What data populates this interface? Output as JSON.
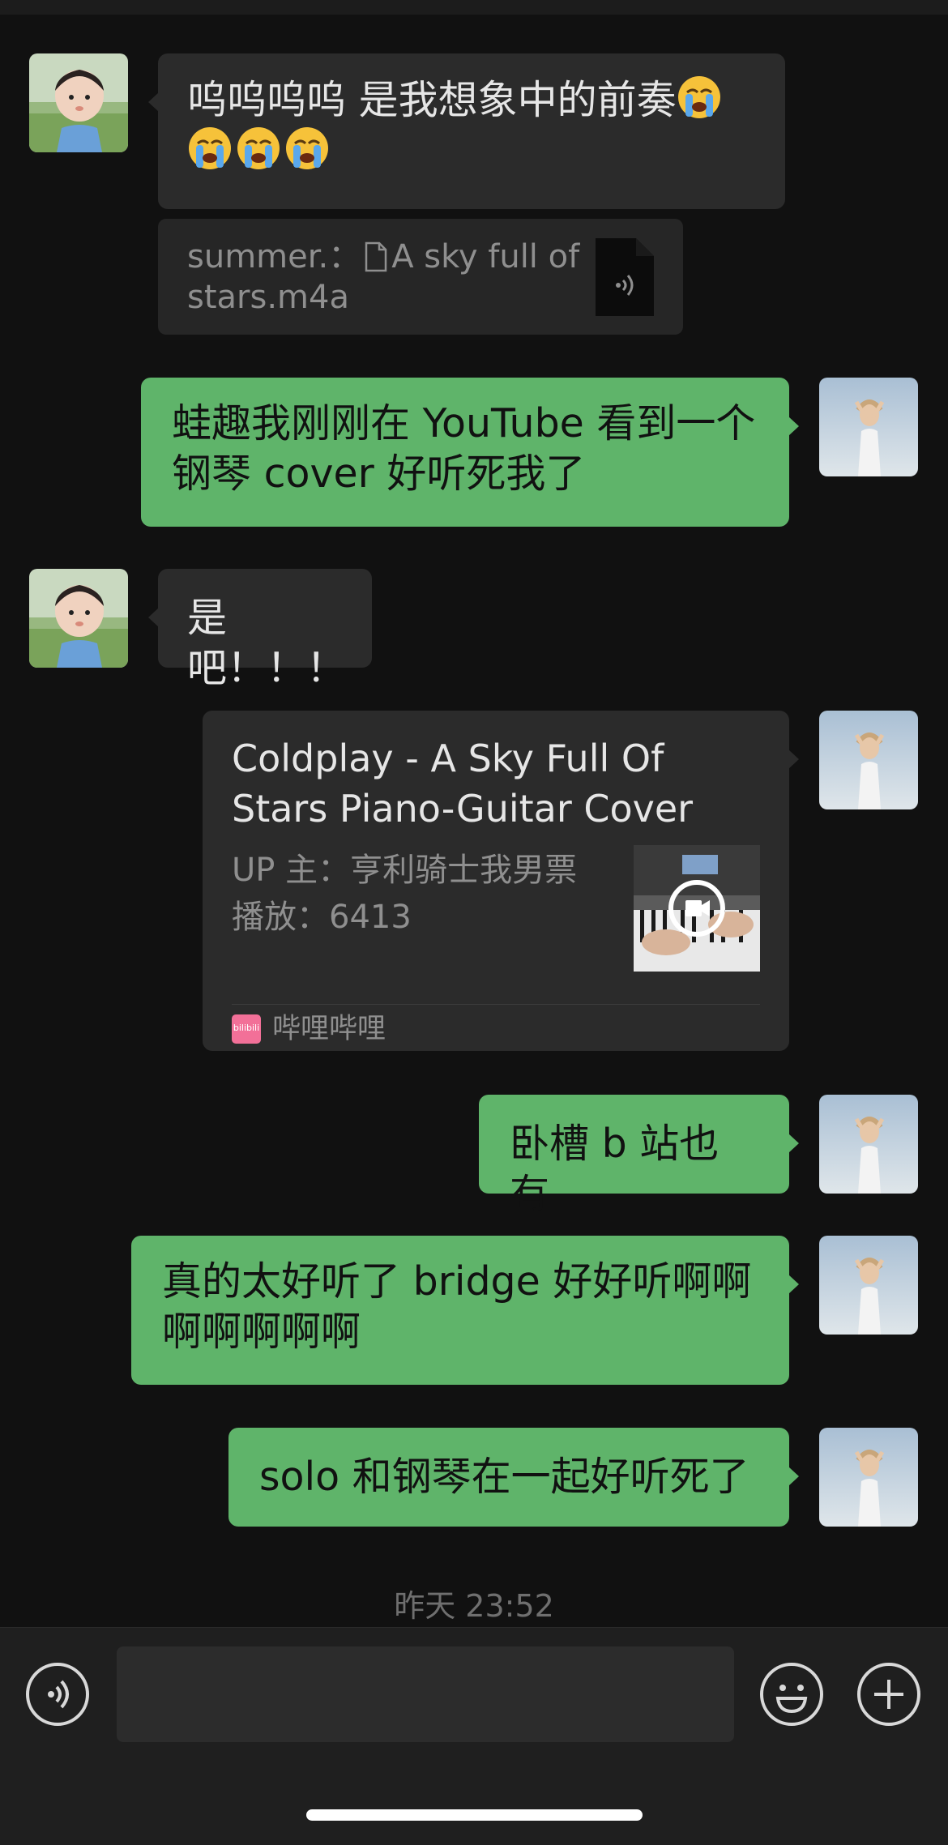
{
  "messages": [
    {
      "side": "in",
      "text": "呜呜呜呜 是我想象中的前奏",
      "emoji_count": 4,
      "emoji": "loudly-crying-face"
    },
    {
      "side": "in",
      "type": "quote",
      "sender": "summer.：",
      "file": "A sky full of stars.m4a",
      "icon": "audio-file-icon"
    },
    {
      "side": "out",
      "text": "蛙趣我刚刚在 YouTube 看到一个钢琴 cover 好听死我了"
    },
    {
      "side": "in",
      "text": "是吧！！！"
    },
    {
      "side": "out",
      "type": "video-card",
      "title": "Coldplay - A Sky Full Of Stars Piano-Guitar Cover",
      "uploader": "UP 主：亨利骑士我男票",
      "plays": "播放：6413",
      "source": "哔哩哔哩",
      "source_logo_text": "bilibili"
    },
    {
      "side": "out",
      "text": "卧槽 b 站也有"
    },
    {
      "side": "out",
      "text": "真的太好听了 bridge 好好听啊啊啊啊啊啊啊"
    },
    {
      "side": "out",
      "text": "solo 和钢琴在一起好听死了"
    }
  ],
  "timestamp": "昨天 23:52",
  "input": {
    "value": "",
    "placeholder": ""
  },
  "icons": {
    "voice": "voice-icon",
    "emoji": "emoji-icon",
    "more": "plus-icon"
  },
  "colors": {
    "background": "#111111",
    "bubble_in": "#2b2b2b",
    "bubble_out": "#5fb46a",
    "input_bar": "#1f1f1f"
  }
}
